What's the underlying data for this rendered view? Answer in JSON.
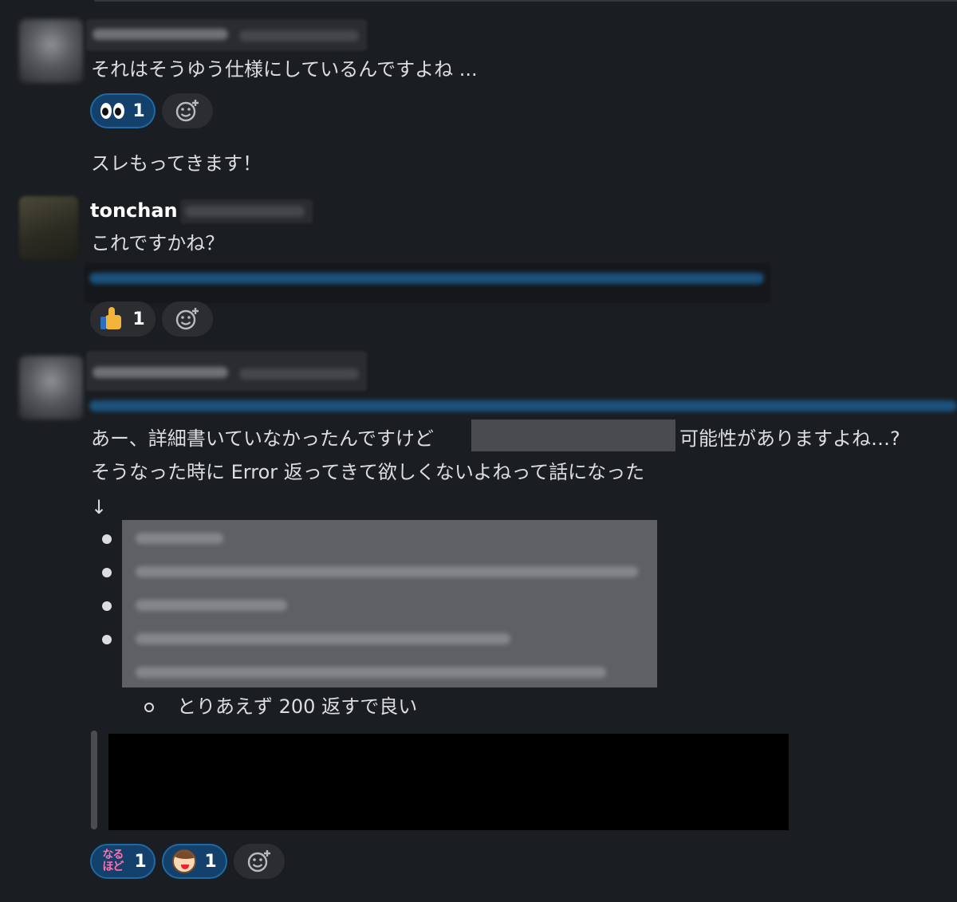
{
  "messages": [
    {
      "text": "それはそうゆう仕様にしているんですよね ...",
      "reactions": [
        {
          "emoji": "eyes",
          "count": "1"
        }
      ],
      "add_reaction_icon": "add-reaction-icon"
    },
    {
      "text": "スレもってきます！"
    },
    {
      "username": "tonchan",
      "text": "これですかね？",
      "reactions": [
        {
          "emoji": "thumbsup",
          "count": "1"
        }
      ],
      "add_reaction_icon": "add-reaction-icon"
    },
    {
      "line1_before": "あー、詳細書いていなかったんですけど",
      "line1_after": "可能性がありますよね…?",
      "line2": "そうなった時に Error 返ってきて欲しくないよねって話になった",
      "arrow": "↓",
      "sub_item": "とりあえず 200 返すで良い",
      "reactions": [
        {
          "emoji": "naruhodo",
          "label": "なるほど",
          "count": "1"
        },
        {
          "emoji": "face",
          "count": "1"
        }
      ],
      "add_reaction_icon": "add-reaction-icon"
    }
  ],
  "colors": {
    "background": "#1a1d21",
    "reaction_active": "#14406c",
    "reaction_border": "#1d6aa5",
    "link_blurred": "#1d6aa5"
  }
}
